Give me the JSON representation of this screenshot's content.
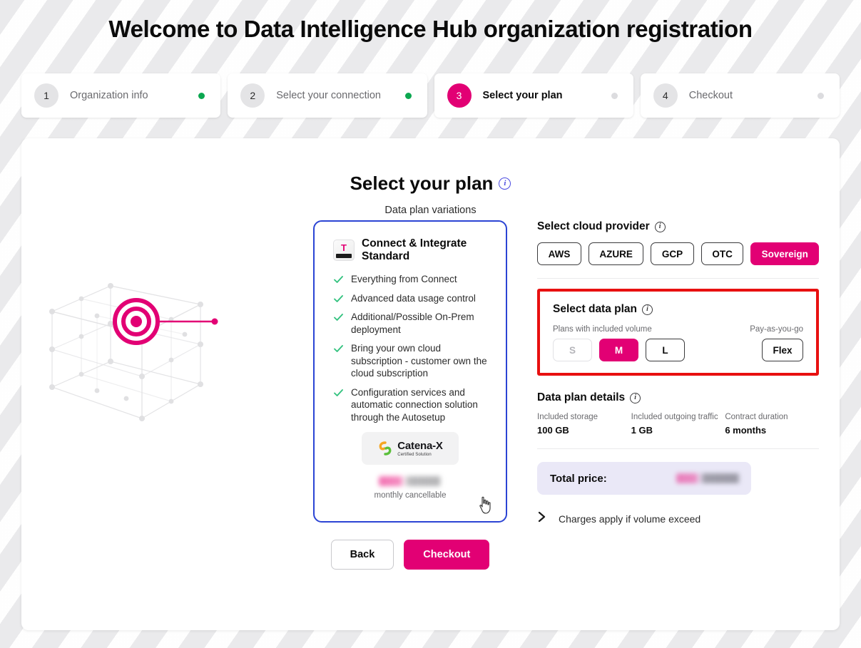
{
  "header": {
    "title": "Welcome to Data Intelligence Hub organization registration"
  },
  "stepper": {
    "steps": [
      {
        "number": "1",
        "label": "Organization info",
        "state": "done"
      },
      {
        "number": "2",
        "label": "Select your connection",
        "state": "done"
      },
      {
        "number": "3",
        "label": "Select your plan",
        "state": "active"
      },
      {
        "number": "4",
        "label": "Checkout",
        "state": "pending"
      }
    ]
  },
  "main": {
    "title": "Select your plan",
    "subtitle": "Data plan variations",
    "info_icon": "info-icon"
  },
  "plan_card": {
    "brand_logo": "telekom-t-logo",
    "title": "Connect & Integrate Standard",
    "features": [
      "Everything from Connect",
      "Advanced data usage control",
      "Additional/Possible On-Prem deployment",
      "Bring your own cloud subscription - customer own the cloud subscription",
      "Configuration services and automatic connection solution through the Autosetup"
    ],
    "certification": {
      "name": "Catena-X",
      "subtitle": "Certified Solution"
    },
    "price_redacted": true,
    "cancellable_note": "monthly cancellable"
  },
  "actions": {
    "back_label": "Back",
    "checkout_label": "Checkout"
  },
  "cloud_provider": {
    "title": "Select cloud provider",
    "options": [
      {
        "label": "AWS",
        "state": "normal"
      },
      {
        "label": "AZURE",
        "state": "normal"
      },
      {
        "label": "GCP",
        "state": "normal"
      },
      {
        "label": "OTC",
        "state": "normal"
      },
      {
        "label": "Sovereign",
        "state": "selected"
      }
    ]
  },
  "data_plan": {
    "title": "Select data plan",
    "included_volume_label": "Plans with included volume",
    "payg_label": "Pay-as-you-go",
    "sizes": [
      {
        "label": "S",
        "state": "disabled"
      },
      {
        "label": "M",
        "state": "selected"
      },
      {
        "label": "L",
        "state": "normal"
      }
    ],
    "flex": {
      "label": "Flex",
      "state": "normal"
    },
    "highlight_color": "#e81010"
  },
  "data_plan_details": {
    "title": "Data plan details",
    "items": [
      {
        "label": "Included storage",
        "value": "100 GB"
      },
      {
        "label": "Included outgoing traffic",
        "value": "1 GB"
      },
      {
        "label": "Contract duration",
        "value": "6 months"
      }
    ],
    "total_price_label": "Total price:",
    "total_price_redacted": true,
    "charges_note": "Charges apply if volume exceed"
  },
  "colors": {
    "magenta": "#e20074",
    "blue_border": "#2b44d4",
    "green_dot": "#0ca750",
    "red_highlight": "#e81010",
    "lavender": "#eae8f7"
  }
}
